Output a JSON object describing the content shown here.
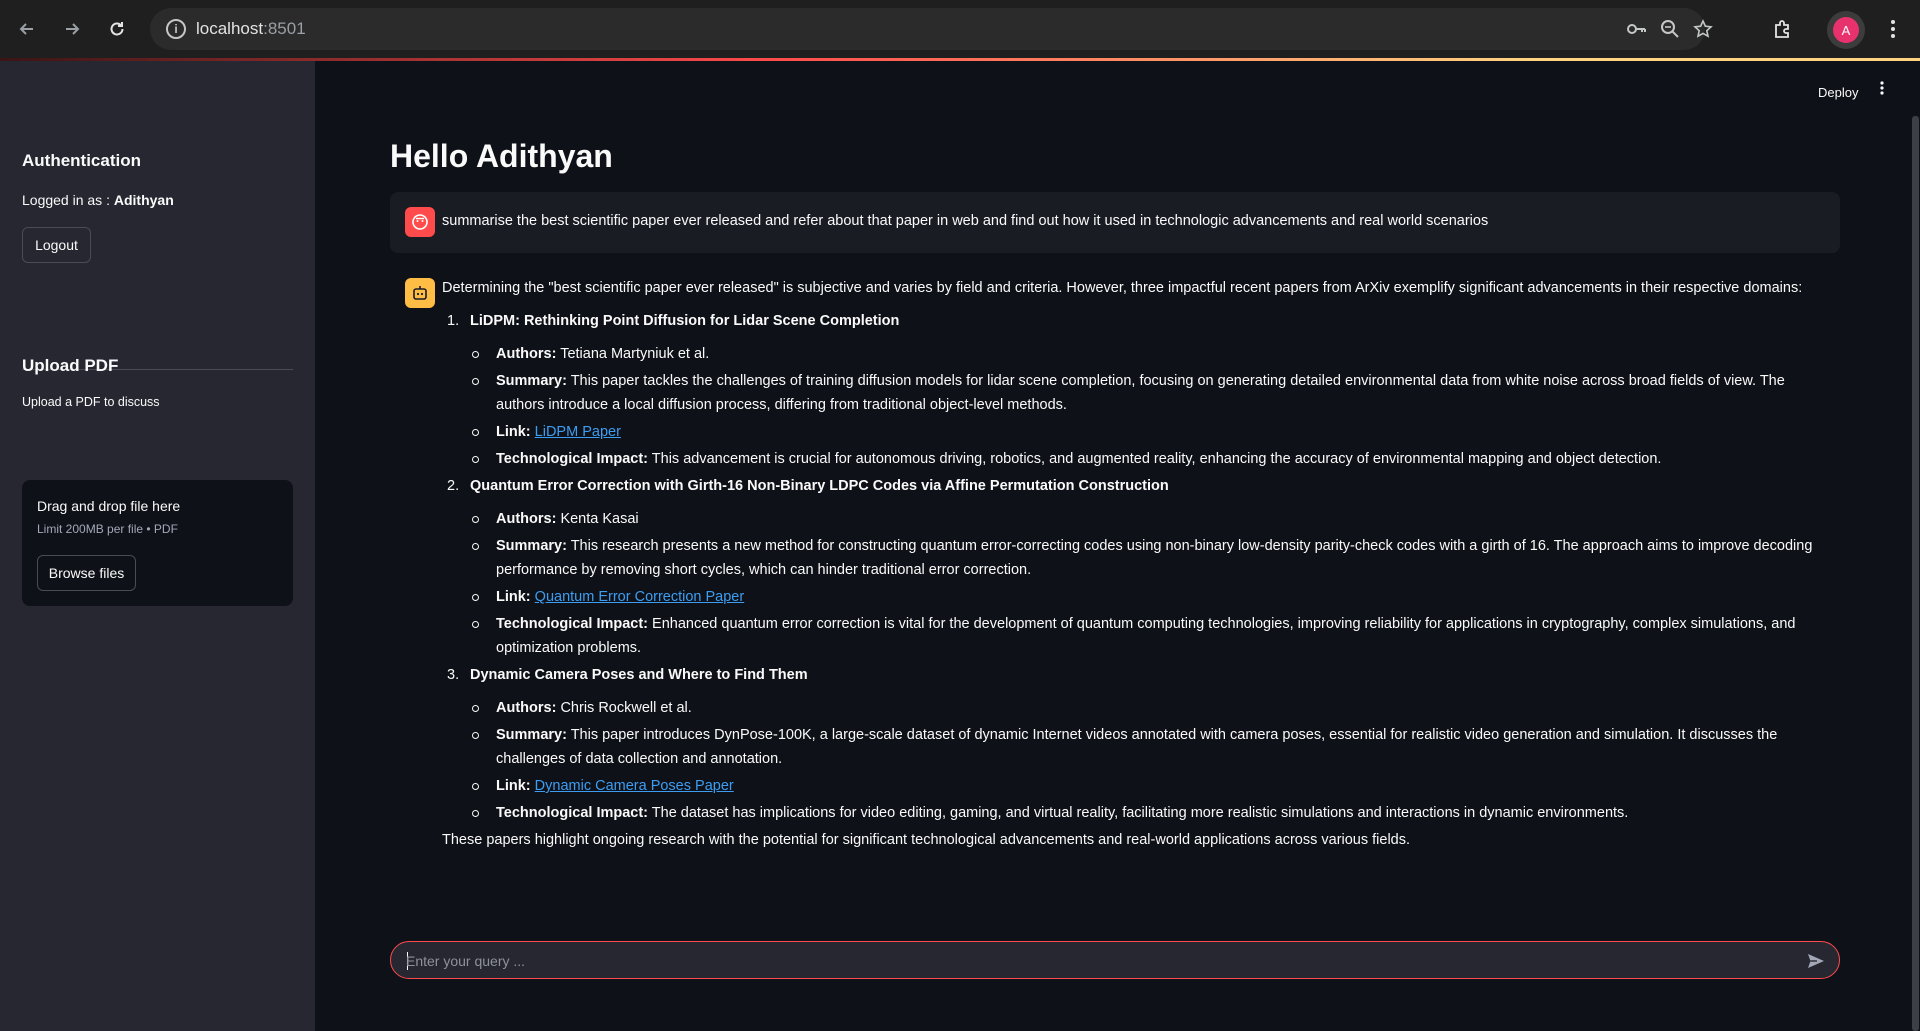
{
  "browser": {
    "url_host": "localhost",
    "url_port": ":8501",
    "avatar_letter": "A"
  },
  "sidebar": {
    "auth_heading": "Authentication",
    "logged_in_prefix": "Logged in as : ",
    "logged_in_user": "Adithyan",
    "logout_label": "Logout",
    "upload_heading": "Upload PDF",
    "upload_caption": "Upload a PDF to discuss",
    "dropzone_title": "Drag and drop file here",
    "dropzone_limit": "Limit 200MB per file • PDF",
    "browse_label": "Browse files"
  },
  "header": {
    "deploy_label": "Deploy"
  },
  "main": {
    "title": "Hello Adithyan",
    "user_message": "summarise the best scientific paper ever released and refer about that paper in web and find out how it used in technologic advancements and real world scenarios",
    "bot_intro": "Determining the \"best scientific paper ever released\" is subjective and varies by field and criteria. However, three impactful recent papers from ArXiv exemplify significant advancements in their respective domains:",
    "papers": [
      {
        "num": "1.",
        "title": "LiDPM: Rethinking Point Diffusion for Lidar Scene Completion",
        "authors_label": "Authors:",
        "authors": " Tetiana Martyniuk et al.",
        "summary_label": "Summary:",
        "summary": " This paper tackles the challenges of training diffusion models for lidar scene completion, focusing on generating detailed environmental data from white noise across broad fields of view. The authors introduce a local diffusion process, differing from traditional object-level methods.",
        "link_label": "Link:",
        "link_text": "LiDPM Paper",
        "impact_label": "Technological Impact:",
        "impact": " This advancement is crucial for autonomous driving, robotics, and augmented reality, enhancing the accuracy of environmental mapping and object detection."
      },
      {
        "num": "2.",
        "title": "Quantum Error Correction with Girth-16 Non-Binary LDPC Codes via Affine Permutation Construction",
        "authors_label": "Authors:",
        "authors": " Kenta Kasai",
        "summary_label": "Summary:",
        "summary": " This research presents a new method for constructing quantum error-correcting codes using non-binary low-density parity-check codes with a girth of 16. The approach aims to improve decoding performance by removing short cycles, which can hinder traditional error correction.",
        "link_label": "Link:",
        "link_text": "Quantum Error Correction Paper",
        "impact_label": "Technological Impact:",
        "impact": " Enhanced quantum error correction is vital for the development of quantum computing technologies, improving reliability for applications in cryptography, complex simulations, and optimization problems."
      },
      {
        "num": "3.",
        "title": "Dynamic Camera Poses and Where to Find Them",
        "authors_label": "Authors:",
        "authors": " Chris Rockwell et al.",
        "summary_label": "Summary:",
        "summary": " This paper introduces DynPose-100K, a large-scale dataset of dynamic Internet videos annotated with camera poses, essential for realistic video generation and simulation. It discusses the challenges of data collection and annotation.",
        "link_label": "Link:",
        "link_text": "Dynamic Camera Poses Paper",
        "impact_label": "Technological Impact:",
        "impact": " The dataset has implications for video editing, gaming, and virtual reality, facilitating more realistic simulations and interactions in dynamic environments."
      }
    ],
    "bot_closing": "These papers highlight ongoing research with the potential for significant technological advancements and real-world applications across various fields.",
    "input_placeholder": "Enter your query ..."
  },
  "colors": {
    "accent": "#ff4b4b",
    "bot_avatar": "#ffbd45",
    "link": "#3d9df3",
    "sidebar_bg": "#262730",
    "main_bg": "#0e1117"
  }
}
